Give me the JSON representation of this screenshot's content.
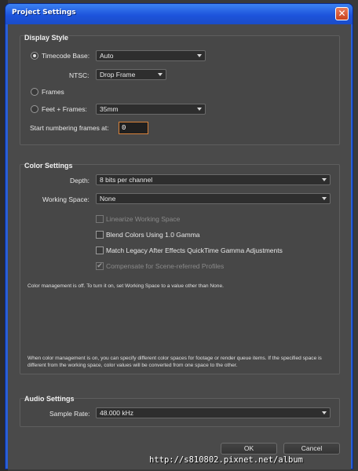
{
  "window": {
    "title": "Project Settings"
  },
  "display_style": {
    "title": "Display Style",
    "timecode_base_label": "Timecode Base:",
    "timecode_base_value": "Auto",
    "ntsc_label": "NTSC:",
    "ntsc_value": "Drop Frame",
    "frames_label": "Frames",
    "feet_frames_label": "Feet + Frames:",
    "feet_frames_value": "35mm",
    "start_numbering_label": "Start numbering frames at:",
    "start_numbering_value": "0"
  },
  "color_settings": {
    "title": "Color Settings",
    "depth_label": "Depth:",
    "depth_value": "8 bits per channel",
    "working_space_label": "Working Space:",
    "working_space_value": "None",
    "linearize_label": "Linearize Working Space",
    "blend_label": "Blend Colors Using 1.0 Gamma",
    "match_legacy_label": "Match Legacy After Effects QuickTime Gamma Adjustments",
    "compensate_label": "Compensate for Scene-referred Profiles",
    "note_off": "Color management is off. To turn it on, set Working Space to a value other than None.",
    "note_on": "When color management is on, you can specify different color spaces for footage or render queue items. If the specified space is different from the working space, color values will be converted from one space to the other."
  },
  "audio_settings": {
    "title": "Audio Settings",
    "sample_rate_label": "Sample Rate:",
    "sample_rate_value": "48.000 kHz"
  },
  "buttons": {
    "ok": "OK",
    "cancel": "Cancel"
  },
  "watermark": "http://s810802.pixnet.net/album"
}
